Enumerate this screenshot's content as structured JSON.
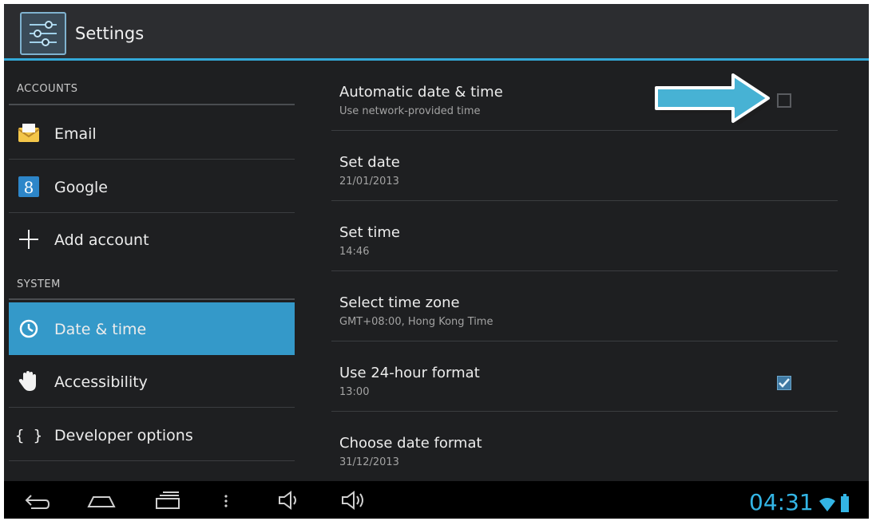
{
  "app": {
    "title": "Settings",
    "icon": "settings-sliders-icon"
  },
  "sidebar": {
    "sections": [
      {
        "label": "ACCOUNTS"
      },
      {
        "label": "SYSTEM"
      }
    ],
    "items": [
      {
        "label": "Email",
        "icon": "email-icon"
      },
      {
        "label": "Google",
        "icon": "google-icon"
      },
      {
        "label": "Add account",
        "icon": "plus-icon"
      },
      {
        "label": "Date & time",
        "icon": "clock-icon",
        "selected": true
      },
      {
        "label": "Accessibility",
        "icon": "hand-icon"
      },
      {
        "label": "Developer options",
        "icon": "braces-icon"
      }
    ]
  },
  "settings": [
    {
      "title": "Automatic date & time",
      "summary": "Use network-provided time",
      "checkbox": false
    },
    {
      "title": "Set date",
      "summary": "21/01/2013"
    },
    {
      "title": "Set time",
      "summary": "14:46"
    },
    {
      "title": "Select time zone",
      "summary": "GMT+08:00, Hong Kong Time"
    },
    {
      "title": "Use 24-hour format",
      "summary": "13:00",
      "checkbox": true
    },
    {
      "title": "Choose date format",
      "summary": "31/12/2013"
    }
  ],
  "statusbar": {
    "time": "04:31"
  },
  "colors": {
    "accent": "#33b5e5",
    "selected": "#3499c9",
    "background": "#1e1f21"
  }
}
